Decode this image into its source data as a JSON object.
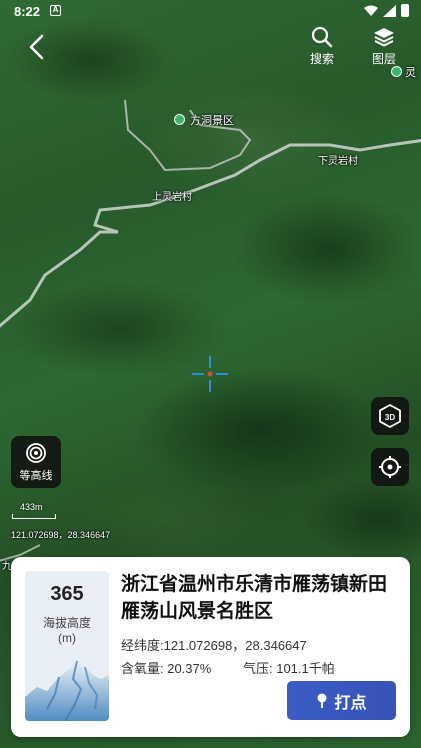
{
  "status_bar": {
    "time": "8:22",
    "notif": "A"
  },
  "toolbar": {
    "search_label": "搜索",
    "layers_label": "图层"
  },
  "map": {
    "poi_scenic": "方洞景区",
    "village_1": "下灵岩村",
    "village_2": "上灵岩村",
    "edge_label_right": "灵",
    "edge_label_left": "九"
  },
  "controls": {
    "contour_label": "等高线",
    "btn_3d_text": "3D"
  },
  "scale": {
    "label": "433m"
  },
  "map_coords": "121.072698，28.346647",
  "info": {
    "altitude_value": "365",
    "altitude_label": "海拔高度",
    "altitude_unit": "(m)",
    "address": "浙江省温州市乐清市雁荡镇新田雁荡山风景名胜区",
    "coords_line": "经纬度:121.072698，28.346647",
    "oxygen_line": "含氧量:  20.37%",
    "pressure_line": "气压:  101.1千帕",
    "mark_button": "打点"
  },
  "colors": {
    "accent": "#3a5cc6",
    "crosshair": "#2f8fd8"
  }
}
